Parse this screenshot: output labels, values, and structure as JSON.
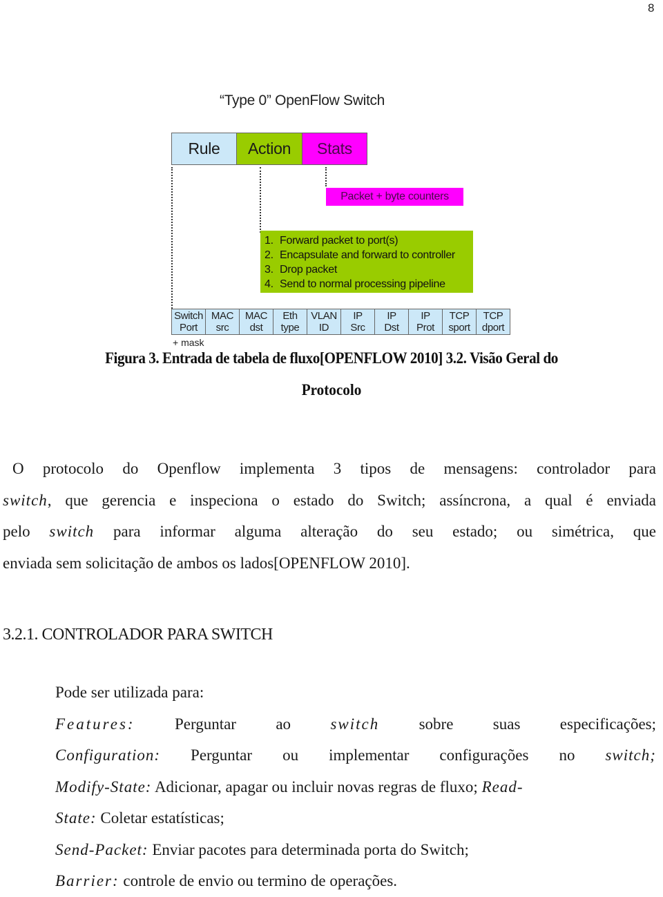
{
  "page_number": "8",
  "figure": {
    "title": "“Type 0” OpenFlow Switch",
    "header_cells": [
      {
        "label": "Rule",
        "color": "#cce8f8"
      },
      {
        "label": "Action",
        "color": "#99cc00"
      },
      {
        "label": "Stats",
        "color": "#ff00ff"
      }
    ],
    "stats_detail": "Packet + byte counters",
    "actions": [
      {
        "n": "1.",
        "text": "Forward packet to port(s)"
      },
      {
        "n": "2.",
        "text": "Encapsulate and forward to controller"
      },
      {
        "n": "3.",
        "text": "Drop packet"
      },
      {
        "n": "4.",
        "text": "Send to normal processing pipeline"
      }
    ],
    "fields": [
      {
        "top": "Switch",
        "bottom": "Port"
      },
      {
        "top": "MAC",
        "bottom": "src"
      },
      {
        "top": "MAC",
        "bottom": "dst"
      },
      {
        "top": "Eth",
        "bottom": "type"
      },
      {
        "top": "VLAN",
        "bottom": "ID"
      },
      {
        "top": "IP",
        "bottom": "Src"
      },
      {
        "top": "IP",
        "bottom": "Dst"
      },
      {
        "top": "IP",
        "bottom": "Prot"
      },
      {
        "top": "TCP",
        "bottom": "sport"
      },
      {
        "top": "TCP",
        "bottom": "dport"
      }
    ],
    "mask_note": "+ mask"
  },
  "caption": {
    "line1": "Figura 3. Entrada de tabela de fluxo[OPENFLOW 2010] 3.2. Visão Geral do",
    "line2": "Protocolo"
  },
  "paragraph": {
    "l1": "O protocolo do Openflow implementa 3 tipos de mensagens: controlador para",
    "l2_italic": "switch",
    "l2_rest": ", que gerencia e inspeciona o estado do Switch; assíncrona, a qual é enviada",
    "l3_a": "pelo ",
    "l3_italic": "switch",
    "l3_b": " para informar alguma alteração do seu estado; ou simétrica, que",
    "l4": "enviada sem solicitação de ambos os lados[OPENFLOW 2010]."
  },
  "section_heading": "3.2.1. CONTROLADOR PARA SWITCH",
  "list": {
    "intro": "Pode ser utilizada para:",
    "features_term": "Features:",
    "features_words": [
      "Perguntar",
      "ao",
      "switch",
      "sobre",
      "suas",
      "especificações;"
    ],
    "config_term": "Configuration:",
    "config_words": [
      "Perguntar",
      "ou",
      "implementar",
      "configurações",
      "no",
      "switch;"
    ],
    "modify_term": "Modify-State:",
    "modify_text": " Adicionar, apagar ou incluir novas regras de fluxo; ",
    "read_term_a": "Read-",
    "read_term_b": "State:",
    "read_text": " Coletar estatísticas;",
    "send_term": "Send-Packet:",
    "send_text": " Enviar pacotes para determinada porta do Switch;",
    "barrier_term": "Barrier:",
    "barrier_text": " controle de envio ou termino de operações."
  }
}
